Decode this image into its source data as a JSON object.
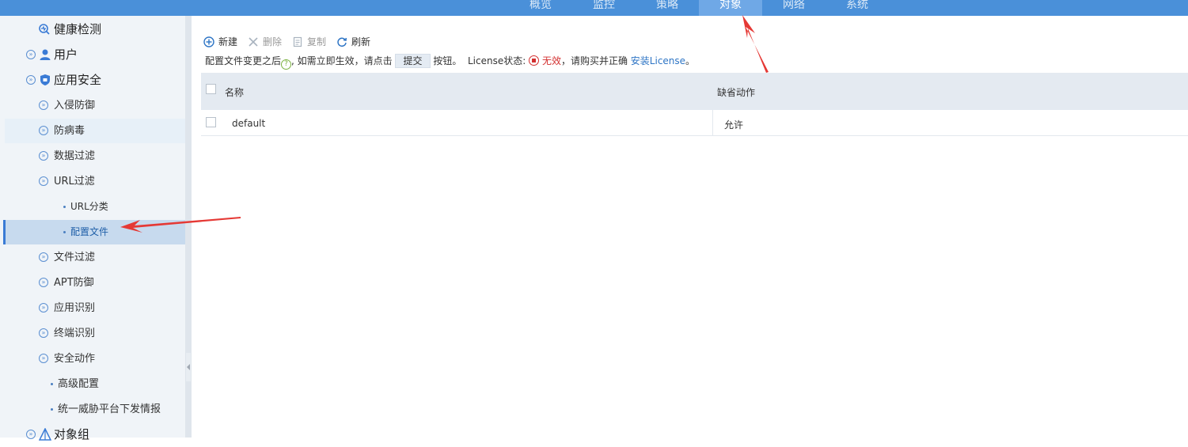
{
  "nav": {
    "tabs": [
      {
        "label": "概览",
        "active": false
      },
      {
        "label": "监控",
        "active": false
      },
      {
        "label": "策略",
        "active": false
      },
      {
        "label": "对象",
        "active": true
      },
      {
        "label": "网络",
        "active": false
      },
      {
        "label": "系统",
        "active": false
      }
    ]
  },
  "sidebar": {
    "items": [
      {
        "label": "健康检测",
        "level": 1,
        "icon": "health-check-icon"
      },
      {
        "label": "用户",
        "level": 1,
        "icon": "user-icon"
      },
      {
        "label": "应用安全",
        "level": 1,
        "icon": "shield-icon"
      },
      {
        "label": "入侵防御",
        "level": 2
      },
      {
        "label": "防病毒",
        "level": 2
      },
      {
        "label": "数据过滤",
        "level": 2
      },
      {
        "label": "URL过滤",
        "level": 2
      },
      {
        "label": "URL分类",
        "level": 3
      },
      {
        "label": "配置文件",
        "level": 3,
        "selected": true
      },
      {
        "label": "文件过滤",
        "level": 2
      },
      {
        "label": "APT防御",
        "level": 2
      },
      {
        "label": "应用识别",
        "level": 2
      },
      {
        "label": "终端识别",
        "level": 2
      },
      {
        "label": "安全动作",
        "level": 2
      },
      {
        "label": "高级配置",
        "level": 3
      },
      {
        "label": "统一威胁平台下发情报",
        "level": 3
      },
      {
        "label": "对象组",
        "level": 1,
        "icon": "object-group-icon"
      }
    ]
  },
  "toolbar": {
    "new_label": "新建",
    "delete_label": "删除",
    "copy_label": "复制",
    "refresh_label": "刷新"
  },
  "notice": {
    "text1": "配置文件变更之后",
    "text2": ", 如需立即生效，请点击",
    "submit_label": "提交",
    "text3": "按钮。",
    "license_label": "License状态:",
    "license_status": "无效",
    "text4": "，请购买并正确",
    "install_link": "安装License",
    "text5": "。"
  },
  "table": {
    "columns": [
      "名称",
      "缺省动作"
    ],
    "rows": [
      {
        "name": "default",
        "action": "允许"
      }
    ]
  },
  "colors": {
    "nav_bg": "#4a90d9",
    "nav_active": "#6fa8e6",
    "sidebar_bg": "#f0f4f8",
    "selected_bg": "#c7daee",
    "accent_blue": "#2e75c5",
    "status_red": "#d32f2f",
    "annotation_arrow": "#e53935"
  }
}
